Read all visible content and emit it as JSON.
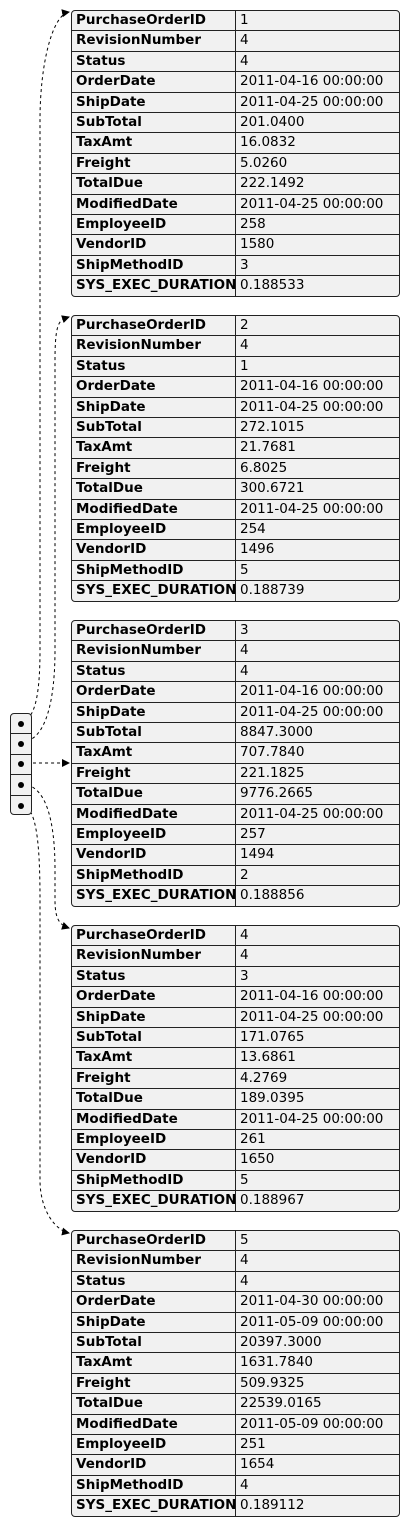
{
  "records": [
    {
      "rows": [
        {
          "key": "PurchaseOrderID",
          "value": "1"
        },
        {
          "key": "RevisionNumber",
          "value": "4"
        },
        {
          "key": "Status",
          "value": "4"
        },
        {
          "key": "OrderDate",
          "value": "2011-04-16 00:00:00"
        },
        {
          "key": "ShipDate",
          "value": "2011-04-25 00:00:00"
        },
        {
          "key": "SubTotal",
          "value": "201.0400"
        },
        {
          "key": "TaxAmt",
          "value": "16.0832"
        },
        {
          "key": "Freight",
          "value": "5.0260"
        },
        {
          "key": "TotalDue",
          "value": "222.1492"
        },
        {
          "key": "ModifiedDate",
          "value": "2011-04-25 00:00:00"
        },
        {
          "key": "EmployeeID",
          "value": "258"
        },
        {
          "key": "VendorID",
          "value": "1580"
        },
        {
          "key": "ShipMethodID",
          "value": "3"
        },
        {
          "key": "SYS_EXEC_DURATION",
          "value": "0.188533"
        }
      ]
    },
    {
      "rows": [
        {
          "key": "PurchaseOrderID",
          "value": "2"
        },
        {
          "key": "RevisionNumber",
          "value": "4"
        },
        {
          "key": "Status",
          "value": "1"
        },
        {
          "key": "OrderDate",
          "value": "2011-04-16 00:00:00"
        },
        {
          "key": "ShipDate",
          "value": "2011-04-25 00:00:00"
        },
        {
          "key": "SubTotal",
          "value": "272.1015"
        },
        {
          "key": "TaxAmt",
          "value": "21.7681"
        },
        {
          "key": "Freight",
          "value": "6.8025"
        },
        {
          "key": "TotalDue",
          "value": "300.6721"
        },
        {
          "key": "ModifiedDate",
          "value": "2011-04-25 00:00:00"
        },
        {
          "key": "EmployeeID",
          "value": "254"
        },
        {
          "key": "VendorID",
          "value": "1496"
        },
        {
          "key": "ShipMethodID",
          "value": "5"
        },
        {
          "key": "SYS_EXEC_DURATION",
          "value": "0.188739"
        }
      ]
    },
    {
      "rows": [
        {
          "key": "PurchaseOrderID",
          "value": "3"
        },
        {
          "key": "RevisionNumber",
          "value": "4"
        },
        {
          "key": "Status",
          "value": "4"
        },
        {
          "key": "OrderDate",
          "value": "2011-04-16 00:00:00"
        },
        {
          "key": "ShipDate",
          "value": "2011-04-25 00:00:00"
        },
        {
          "key": "SubTotal",
          "value": "8847.3000"
        },
        {
          "key": "TaxAmt",
          "value": "707.7840"
        },
        {
          "key": "Freight",
          "value": "221.1825"
        },
        {
          "key": "TotalDue",
          "value": "9776.2665"
        },
        {
          "key": "ModifiedDate",
          "value": "2011-04-25 00:00:00"
        },
        {
          "key": "EmployeeID",
          "value": "257"
        },
        {
          "key": "VendorID",
          "value": "1494"
        },
        {
          "key": "ShipMethodID",
          "value": "2"
        },
        {
          "key": "SYS_EXEC_DURATION",
          "value": "0.188856"
        }
      ]
    },
    {
      "rows": [
        {
          "key": "PurchaseOrderID",
          "value": "4"
        },
        {
          "key": "RevisionNumber",
          "value": "4"
        },
        {
          "key": "Status",
          "value": "3"
        },
        {
          "key": "OrderDate",
          "value": "2011-04-16 00:00:00"
        },
        {
          "key": "ShipDate",
          "value": "2011-04-25 00:00:00"
        },
        {
          "key": "SubTotal",
          "value": "171.0765"
        },
        {
          "key": "TaxAmt",
          "value": "13.6861"
        },
        {
          "key": "Freight",
          "value": "4.2769"
        },
        {
          "key": "TotalDue",
          "value": "189.0395"
        },
        {
          "key": "ModifiedDate",
          "value": "2011-04-25 00:00:00"
        },
        {
          "key": "EmployeeID",
          "value": "261"
        },
        {
          "key": "VendorID",
          "value": "1650"
        },
        {
          "key": "ShipMethodID",
          "value": "5"
        },
        {
          "key": "SYS_EXEC_DURATION",
          "value": "0.188967"
        }
      ]
    },
    {
      "rows": [
        {
          "key": "PurchaseOrderID",
          "value": "5"
        },
        {
          "key": "RevisionNumber",
          "value": "4"
        },
        {
          "key": "Status",
          "value": "4"
        },
        {
          "key": "OrderDate",
          "value": "2011-04-30 00:00:00"
        },
        {
          "key": "ShipDate",
          "value": "2011-05-09 00:00:00"
        },
        {
          "key": "SubTotal",
          "value": "20397.3000"
        },
        {
          "key": "TaxAmt",
          "value": "1631.7840"
        },
        {
          "key": "Freight",
          "value": "509.9325"
        },
        {
          "key": "TotalDue",
          "value": "22539.0165"
        },
        {
          "key": "ModifiedDate",
          "value": "2011-05-09 00:00:00"
        },
        {
          "key": "EmployeeID",
          "value": "251"
        },
        {
          "key": "VendorID",
          "value": "1654"
        },
        {
          "key": "ShipMethodID",
          "value": "4"
        },
        {
          "key": "SYS_EXEC_DURATION",
          "value": "0.189112"
        }
      ]
    }
  ]
}
